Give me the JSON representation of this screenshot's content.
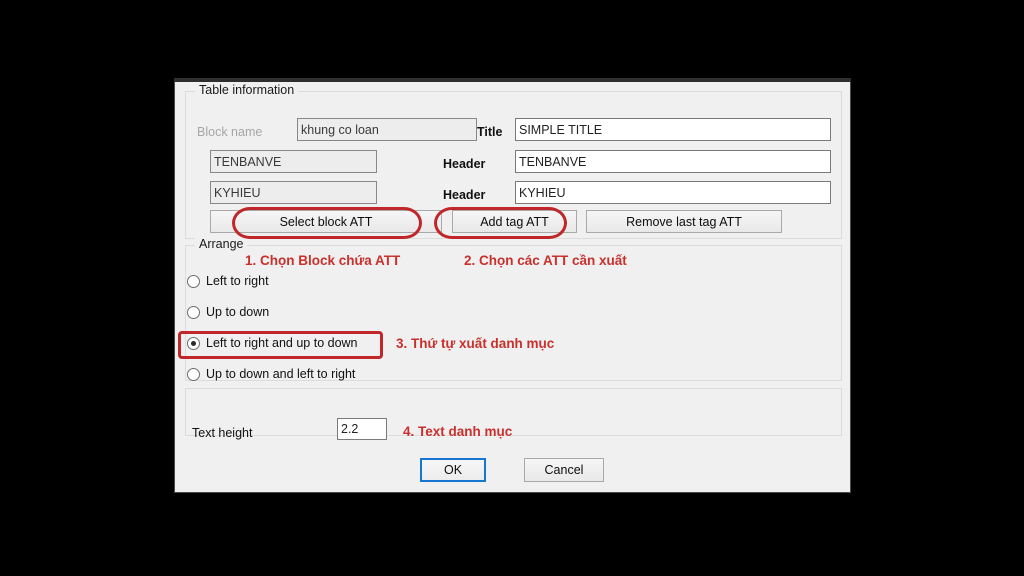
{
  "dialog": {
    "groups": {
      "table_information": "Table information",
      "arrange": "Arrange",
      "text_height_group": ""
    },
    "table_information": {
      "block_name_label": "Block name",
      "block_name_value": "khung co loan",
      "title_label": "Title",
      "title_value": "SIMPLE TITLE",
      "rows": [
        {
          "tag_value": "TENBANVE",
          "header_label": "Header",
          "header_value": "TENBANVE"
        },
        {
          "tag_value": "KYHIEU",
          "header_label": "Header",
          "header_value": "KYHIEU"
        }
      ],
      "buttons": {
        "select_block_att": "Select block ATT",
        "add_tag_att": "Add tag ATT",
        "remove_last_tag_att": "Remove last tag ATT"
      }
    },
    "arrange": {
      "options": [
        {
          "label": "Left to right",
          "selected": false
        },
        {
          "label": "Up to down",
          "selected": false
        },
        {
          "label": "Left to right and up to down",
          "selected": true
        },
        {
          "label": "Up to down and left to right",
          "selected": false
        }
      ]
    },
    "text_height": {
      "label": "Text height",
      "value": "2.2"
    },
    "footer": {
      "ok": "OK",
      "cancel": "Cancel"
    }
  },
  "annotations": [
    {
      "text": "1. Chọn Block chứa ATT"
    },
    {
      "text": "2. Chọn các ATT cần xuất"
    },
    {
      "text": "3. Thứ tự xuất danh mục"
    },
    {
      "text": "4. Text danh mục"
    }
  ],
  "colors": {
    "annotation_red": "#c9302c",
    "highlight_red": "#c0262a",
    "focus_blue": "#1676d2",
    "dialog_background": "#f0f0f0",
    "page_background": "#000000"
  }
}
